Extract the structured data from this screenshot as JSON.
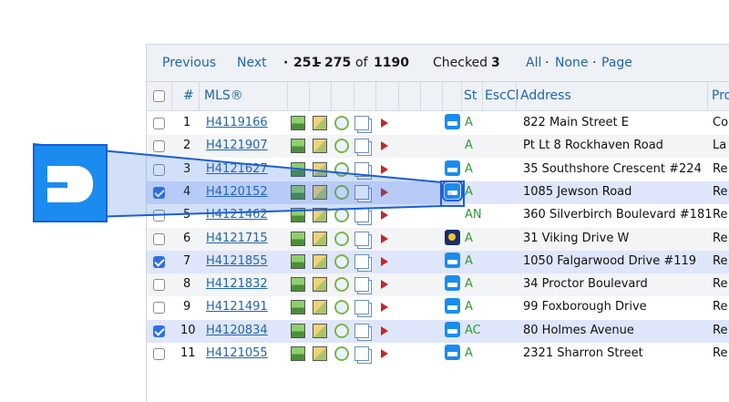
{
  "toolbar": {
    "previous": "Previous",
    "next": "Next",
    "range_bullet": "·",
    "range_start": "251",
    "range_dash": "-",
    "range_end": "275",
    "of_label": "of",
    "total": "1190",
    "checked_label": "Checked",
    "checked_count": "3",
    "all": "All",
    "sep1": "·",
    "none": "None",
    "sep2": "·",
    "page": "Page"
  },
  "columns": {
    "num": "#",
    "mls": "MLS®",
    "st": "St",
    "esc": "EscCl",
    "address": "Address",
    "pro": "Pro"
  },
  "rows": [
    {
      "num": "1",
      "mls": "H4119166",
      "status": "A",
      "address": "822 Main Street E",
      "pro": "Co",
      "checked": false,
      "right_icon": "brand-b-icon"
    },
    {
      "num": "2",
      "mls": "H4121907",
      "status": "A",
      "address": "Pt Lt 8 Rockhaven Road",
      "pro": "La",
      "checked": false,
      "right_icon": ""
    },
    {
      "num": "3",
      "mls": "H4121627",
      "status": "A",
      "address": "35 Southshore Crescent #224",
      "pro": "Re",
      "checked": false,
      "right_icon": "brand-b-icon"
    },
    {
      "num": "4",
      "mls": "H4120152",
      "status": "A",
      "address": "1085 Jewson Road",
      "pro": "Re",
      "checked": true,
      "right_icon": "brand-b-icon"
    },
    {
      "num": "5",
      "mls": "H4121462",
      "status": "AN",
      "address": "360 Silverbirch Boulevard #181",
      "pro": "Re",
      "checked": false,
      "right_icon": ""
    },
    {
      "num": "6",
      "mls": "H4121715",
      "status": "A",
      "address": "31 Viking Drive W",
      "pro": "Re",
      "checked": false,
      "right_icon": "night-sky-icon"
    },
    {
      "num": "7",
      "mls": "H4121855",
      "status": "A",
      "address": "1050 Falgarwood Drive #119",
      "pro": "Re",
      "checked": true,
      "right_icon": "brand-b-icon"
    },
    {
      "num": "8",
      "mls": "H4121832",
      "status": "A",
      "address": "34 Proctor Boulevard",
      "pro": "Re",
      "checked": false,
      "right_icon": "brand-b-icon"
    },
    {
      "num": "9",
      "mls": "H4121491",
      "status": "A",
      "address": "99 Foxborough Drive",
      "pro": "Re",
      "checked": false,
      "right_icon": "brand-b-icon"
    },
    {
      "num": "10",
      "mls": "H4120834",
      "status": "AC",
      "address": "80 Holmes Avenue",
      "pro": "Re",
      "checked": true,
      "right_icon": "brand-b-icon"
    },
    {
      "num": "11",
      "mls": "H4121055",
      "status": "A",
      "address": "2321 Sharron Street",
      "pro": "Re",
      "checked": false,
      "right_icon": "brand-b-icon"
    }
  ],
  "colors": {
    "link": "#2266aa",
    "status_active": "#2f9a2f",
    "checked_row": "#dfe6fb",
    "brand_blue": "#1a8cf0",
    "zoom_highlight": "#1a5ed8"
  }
}
